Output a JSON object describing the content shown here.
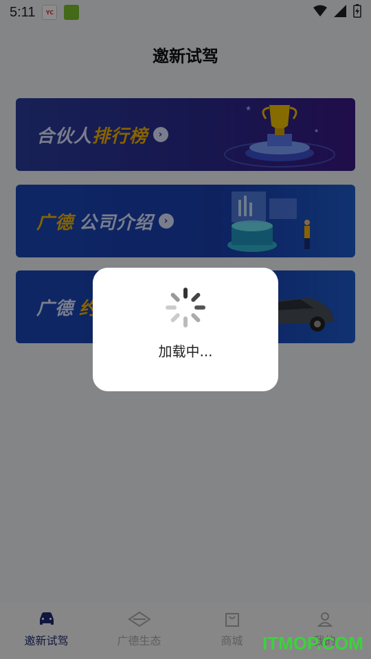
{
  "status_bar": {
    "time": "5:11",
    "app_icon_1": "YC",
    "app_icon_2": "app"
  },
  "page": {
    "title": "邀新试驾"
  },
  "banners": [
    {
      "part1": "合伙人",
      "part2": "排行榜",
      "icon": "trophy-art"
    },
    {
      "part1": "广德",
      "part2": "公司介绍",
      "icon": "data-screen-art"
    },
    {
      "part1": "广德",
      "part2": "约",
      "icon": "car-art"
    }
  ],
  "loading": {
    "text": "加载中..."
  },
  "tabbar": {
    "tabs": [
      {
        "label": "邀新试驾",
        "icon": "car-icon",
        "active": true
      },
      {
        "label": "广德生态",
        "icon": "ecology-icon",
        "active": false
      },
      {
        "label": "商城",
        "icon": "shop-bag-icon",
        "active": false
      },
      {
        "label": "我的",
        "icon": "user-icon",
        "active": false
      }
    ]
  },
  "watermark": "ITMOP.COM",
  "colors": {
    "active_tab": "#1e2a6e",
    "inactive_tab": "#aaaaaa",
    "gold": "#f5b400",
    "watermark": "#3bd23b"
  }
}
